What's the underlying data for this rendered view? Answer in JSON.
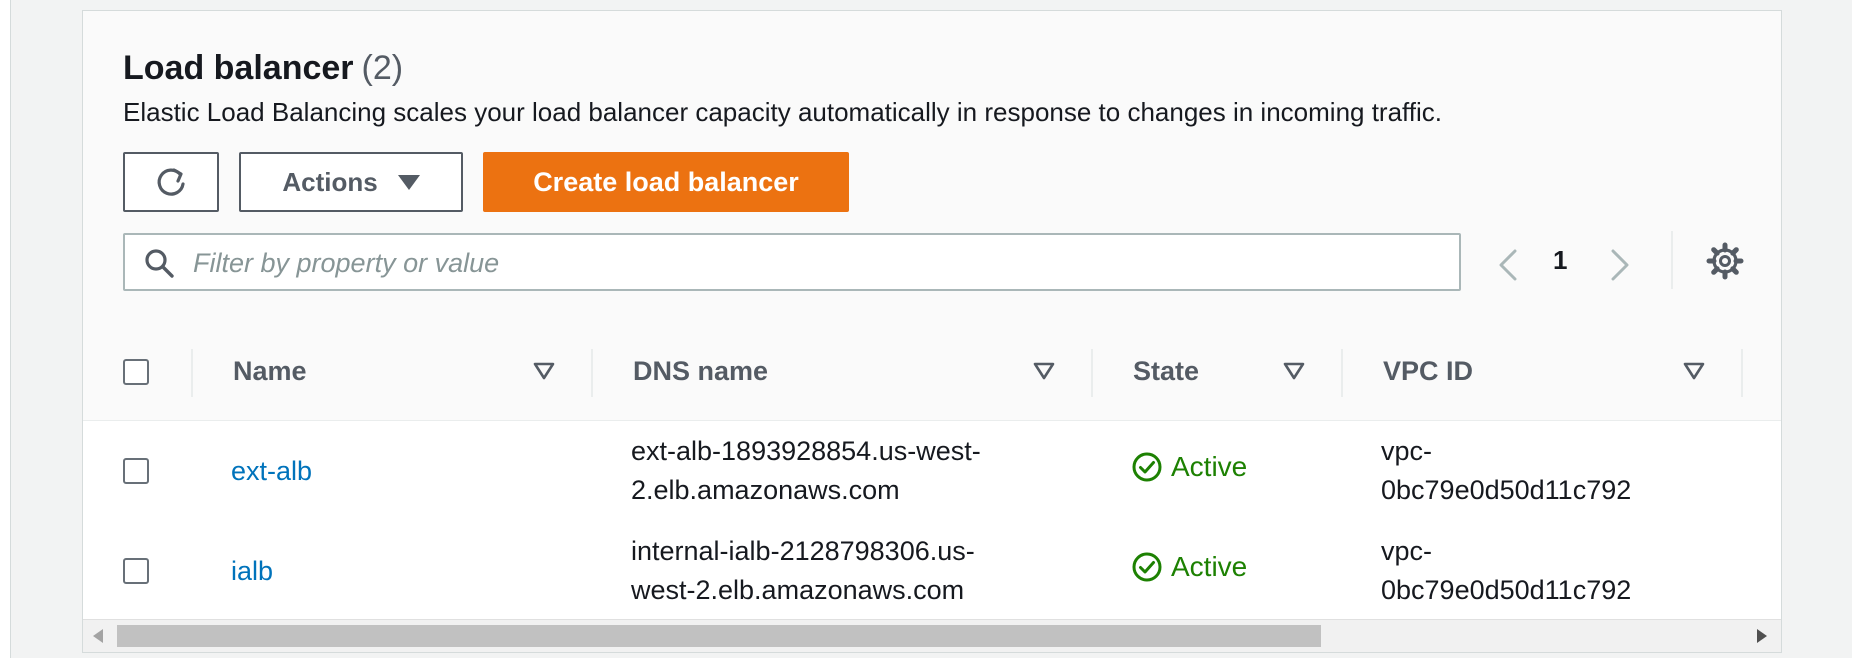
{
  "panel": {
    "title": "Load balancer",
    "count": "(2)",
    "description": "Elastic Load Balancing scales your load balancer capacity automatically in response to changes in incoming traffic."
  },
  "toolbar": {
    "refresh_icon": "refresh-icon",
    "actions_label": "Actions",
    "create_label": "Create load balancer"
  },
  "filter": {
    "placeholder": "Filter by property or value"
  },
  "pagination": {
    "current_page": "1"
  },
  "table": {
    "columns": [
      "Name",
      "DNS name",
      "State",
      "VPC ID"
    ],
    "rows": [
      {
        "name": "ext-alb",
        "dns_line1": "ext-alb-1893928854.us-west-",
        "dns_line2": "2.elb.amazonaws.com",
        "state": "Active",
        "vpc_line1": "vpc-",
        "vpc_line2": "0bc79e0d50d11c792"
      },
      {
        "name": "ialb",
        "dns_line1": "internal-ialb-2128798306.us-",
        "dns_line2": "west-2.elb.amazonaws.com",
        "state": "Active",
        "vpc_line1": "vpc-",
        "vpc_line2": "0bc79e0d50d11c792"
      }
    ]
  },
  "colors": {
    "primary_button": "#ec7211",
    "link": "#0073bb",
    "status_active": "#1d8102"
  }
}
